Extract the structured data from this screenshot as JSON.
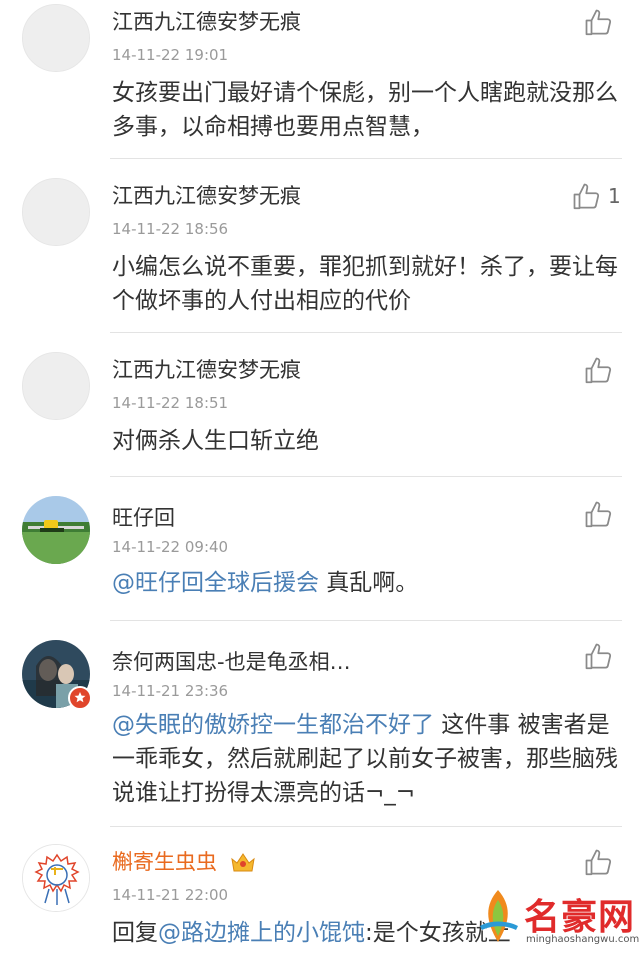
{
  "comments": [
    {
      "author": "江西九江德安梦无痕",
      "time": "14-11-22 19:01",
      "text": "女孩要出门最好请个保彪，别一个人瞎跑就没那么多事，以命相搏也要用点智慧，",
      "likes": ""
    },
    {
      "author": "江西九江德安梦无痕",
      "time": "14-11-22 18:56",
      "text": "小编怎么说不重要，罪犯抓到就好！杀了，要让每个做坏事的人付出相应的代价",
      "likes": "1"
    },
    {
      "author": "江西九江德安梦无痕",
      "time": "14-11-22 18:51",
      "text": "对俩杀人生口斩立绝",
      "likes": ""
    },
    {
      "author": "旺仔回",
      "time": "14-11-22 09:40",
      "mention": "@旺仔回全球后援会",
      "text": " 真乱啊。",
      "likes": ""
    },
    {
      "author": "奈何两国忠-也是龟丞相…",
      "time": "14-11-21 23:36",
      "mention": "@失眠的傲娇控一生都治不好了",
      "text": " 这件事 被害者是一乖乖女，然后就刷起了以前女子被害，那些脑残说谁让打扮得太漂亮的话¬_¬",
      "likes": ""
    },
    {
      "author": "槲寄生虫虫",
      "time": "14-11-21 22:00",
      "prefix": "回复",
      "mention": "@路边摊上的小馄饨",
      "text": ":是个女孩就上",
      "likes": ""
    }
  ],
  "watermark": {
    "title": "名豪网",
    "url": "minghaoshangwu.com"
  },
  "colors": {
    "mention": "#4a7fb5",
    "vip_author": "#e96a1f",
    "time": "#9a9a9a",
    "divider": "#e3e3e3"
  }
}
